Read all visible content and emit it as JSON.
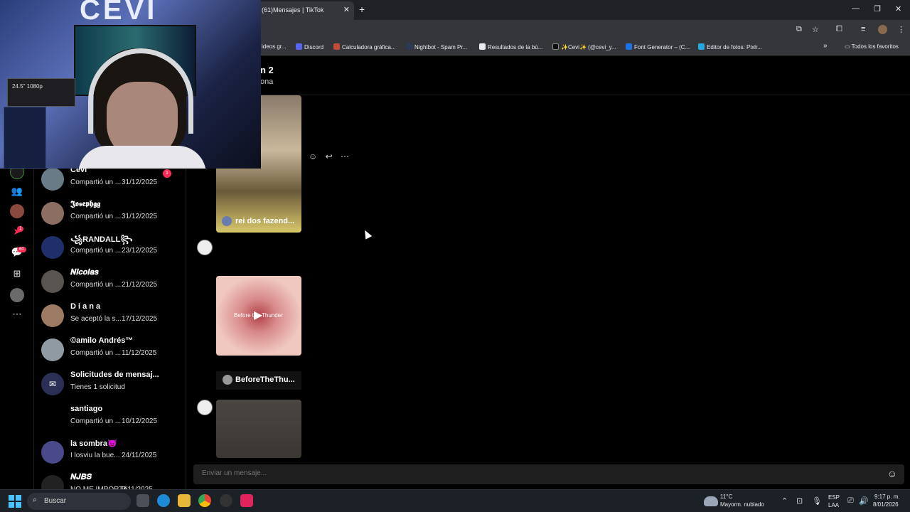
{
  "browser": {
    "tab_title": "(61)Mensajes | TikTok",
    "tab_close": "✕",
    "new_tab": "+",
    "bookmarks": [
      {
        "label": "ideos gr...",
        "color": "#5f6368"
      },
      {
        "label": "Discord",
        "color": "#5865f2"
      },
      {
        "label": "Calculadora gráfica...",
        "color": "#c14a38"
      },
      {
        "label": "Nightbot - Spam Pr...",
        "color": "#2d3a55"
      },
      {
        "label": "Resultados de la bú...",
        "color": "#e8eaed"
      },
      {
        "label": "✨Cevi✨ (@cevi_y...",
        "color": "#111111"
      },
      {
        "label": "Font Generator – (C...",
        "color": "#1a73e8"
      },
      {
        "label": "Editor de fotos: Pixlr...",
        "color": "#26a9e0"
      }
    ],
    "all_favorites": "Todos los favoritos"
  },
  "chat": {
    "title": "n 2",
    "subtitle": "ona",
    "video1_caption": "rei dos fazend...",
    "video2_overlay": "Before the Thunder",
    "video2_creator": "BeforeTheThu...",
    "input_placeholder": "Enviar un mensaje..."
  },
  "rail": {
    "inbox_badge": "60",
    "activity_badge": "1"
  },
  "conversations": [
    {
      "name": "Cevi",
      "preview": "Compartió un ...",
      "date": "31/12/2025",
      "badge": "1",
      "avatar": "#6a7b88"
    },
    {
      "name": "𝕵𝖔𝖘𝖊𝖕𝖍𝖌𝖌",
      "preview": "Compartió un ...",
      "date": "31/12/2025",
      "badge": "",
      "avatar": "#8c6e63"
    },
    {
      "name": "꧁RANDALL꧂",
      "preview": "Compartió un ...",
      "date": "23/12/2025",
      "badge": "",
      "avatar": "#1f2f6a"
    },
    {
      "name": "𝑵𝒊𝒄𝒐𝒍𝒂𝒔",
      "preview": "Compartió un ...",
      "date": "21/12/2025",
      "badge": "",
      "avatar": "#5a5450"
    },
    {
      "name": "D i a n a",
      "preview": "Se aceptó la s...",
      "date": "17/12/2025",
      "badge": "",
      "avatar": "#9c7a63"
    },
    {
      "name": "©amilo Andrés™",
      "preview": "Compartió un ...",
      "date": "11/12/2025",
      "badge": "",
      "avatar": "#8f9aa3"
    },
    {
      "name": "Solicitudes de mensaj...",
      "preview": "Tienes 1 solicitud",
      "date": "",
      "badge": "",
      "avatar": "#2c2f55"
    },
    {
      "name": "santiago",
      "preview": "Compartió un ...",
      "date": "10/12/2025",
      "badge": "",
      "avatar": "#000000"
    },
    {
      "name": "la sombra😈",
      "preview": "I losviu la bue...",
      "date": "24/11/2025",
      "badge": "",
      "avatar": "#4a4a8a"
    },
    {
      "name": "𝑵𝑱𝑩𝑺",
      "preview": "NO ME IMPORTA",
      "date": "9/11/2025",
      "badge": "",
      "avatar": "#222222"
    }
  ],
  "webcam": {
    "logo": "CEVI",
    "monitor_text": "24.5\" 1080p"
  },
  "taskbar": {
    "search_label": "Buscar",
    "weather_temp": "11°C",
    "weather_desc": "Mayorm. nublado",
    "lang_top": "ESP",
    "lang_bottom": "LAA",
    "time": "9:17 p. m.",
    "date": "8/01/2026"
  }
}
